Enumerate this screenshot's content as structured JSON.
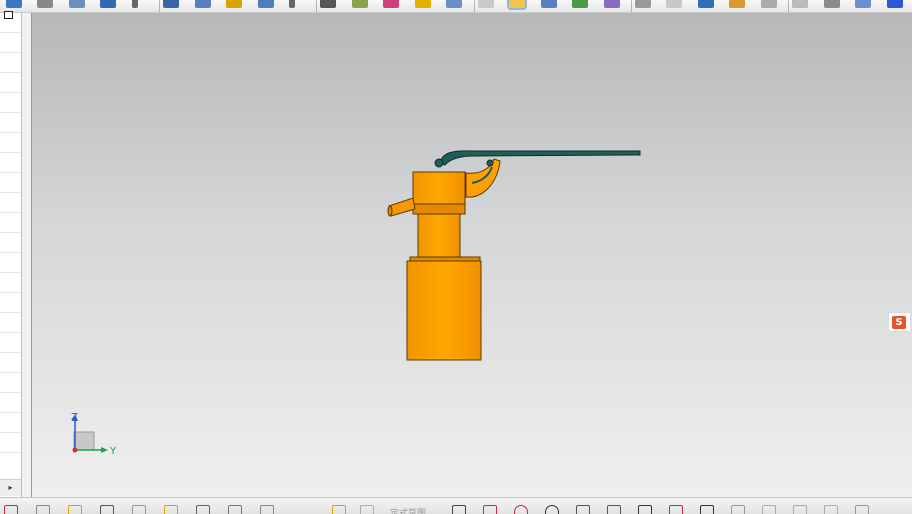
{
  "app": {
    "name": "cad-modeling-window"
  },
  "top_toolbar": {
    "icons": [
      "plus-icon",
      "spline-icon",
      "surface-icon",
      "extrude-icon",
      "dropdown-icon",
      "cylinder-stack-icon",
      "sphere-icon",
      "gold-sphere-icon",
      "blend-icon",
      "dropdown-icon",
      "box-icon",
      "hand-icon",
      "pink-curve-icon",
      "yellow-block-icon",
      "shaded-box-icon",
      "plane-icon",
      "shaded-cube-active-icon",
      "arc-view-icon",
      "texture-icon",
      "colored-texture-icon",
      "gear-part-icon",
      "cloud-icon",
      "blue-box-icon",
      "folder-icon",
      "wire-box-icon",
      "wire-box-2-icon",
      "arrow-tool-icon",
      "wire-cube-icon",
      "blue-cube-icon"
    ],
    "active_icon": "shaded-cube-active-icon"
  },
  "left_panel": {
    "maximize_icon": "maximize-icon",
    "scroll_glyph": "▸"
  },
  "viewport": {
    "background_top": "#b7b8ba",
    "background_bottom": "#efefef",
    "model": {
      "name": "pump-assembly",
      "body_color": "#ffa000",
      "lever_color": "#1f5f5a",
      "outline_color": "#5a3a00"
    },
    "triad": {
      "z_label": "Z",
      "y_label": "Y",
      "z_color": "#2a5bd7",
      "y_color": "#1aa34a",
      "origin_color": "#c0392b"
    },
    "ime_badge": {
      "glyph": "S",
      "color": "#e8542a"
    }
  },
  "bottom_toolbar": {
    "icons": [
      "add-icon",
      "layers-icon",
      "gold-cylinder-icon",
      "move-icon",
      "box-view-icon",
      "spring-icon",
      "ruler-icon",
      "pencil-icon",
      "wire-cube-icon",
      "star-icon",
      "checker-icon",
      "lasso-icon",
      "curve-icon",
      "arc-icon",
      "circle-icon",
      "fillet-icon",
      "corner-icon",
      "rectangle-icon",
      "point-icon",
      "line-icon",
      "eraser-icon",
      "trim-icon",
      "extend-icon",
      "mirror-icon",
      "pin-icon"
    ],
    "view_label": "定式草图"
  }
}
